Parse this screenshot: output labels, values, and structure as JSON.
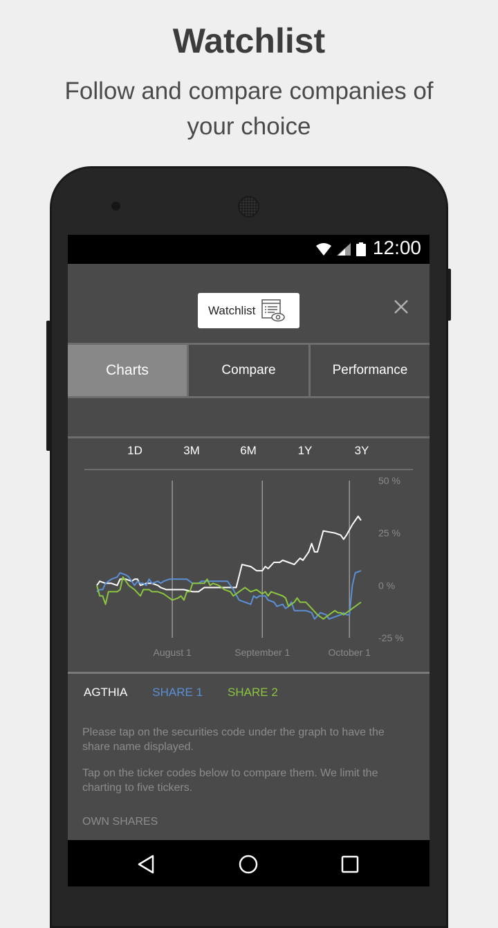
{
  "promo": {
    "title": "Watchlist",
    "subtitle": "Follow and compare companies of your choice"
  },
  "statusbar": {
    "time": "12:00",
    "icons": [
      "wifi-icon",
      "signal-icon",
      "battery-icon"
    ]
  },
  "appbar": {
    "logo_label": "Watchlist",
    "logo_icon": "watchlist-eye-icon",
    "close_icon": "close-icon"
  },
  "tabs": [
    {
      "label": "Charts",
      "active": true
    },
    {
      "label": "Compare",
      "active": false
    },
    {
      "label": "Performance",
      "active": false
    }
  ],
  "ranges": [
    "1D",
    "3M",
    "6M",
    "1Y",
    "3Y"
  ],
  "legend": [
    {
      "label": "AGTHIA",
      "color": "#ffffff"
    },
    {
      "label": "SHARE 1",
      "color": "#5b8fd6"
    },
    {
      "label": "SHARE 2",
      "color": "#8cc63f"
    }
  ],
  "info": {
    "line1": "Please tap on the securities code under the graph to have the share name displayed.",
    "line2": "Tap on the ticker codes below to compare them. We limit the charting to five tickers.",
    "own_shares": "OWN SHARES"
  },
  "navbar": [
    "back-icon",
    "home-icon",
    "recents-icon"
  ],
  "chart_data": {
    "type": "line",
    "title": "",
    "xlabel": "",
    "ylabel": "",
    "x_unit": "days from start (approx. Jul 6)",
    "xlim": [
      0,
      91
    ],
    "ylim": [
      -25,
      50
    ],
    "y_ticks": [
      50,
      25,
      0,
      -25
    ],
    "y_tick_labels": [
      "50 %",
      "25 %",
      "0 %",
      "-25 %"
    ],
    "x_ticks": [
      26,
      57,
      87
    ],
    "x_tick_labels": [
      "August 1",
      "September 1",
      "October 1"
    ],
    "grid": "vertical at x ticks",
    "series": [
      {
        "name": "AGTHIA",
        "color": "#ffffff",
        "points": [
          [
            0,
            0
          ],
          [
            1,
            2
          ],
          [
            3,
            1
          ],
          [
            5,
            1
          ],
          [
            7,
            0
          ],
          [
            8,
            3
          ],
          [
            10,
            3
          ],
          [
            12,
            2
          ],
          [
            13,
            3
          ],
          [
            14,
            3
          ],
          [
            15,
            0
          ],
          [
            17,
            1
          ],
          [
            19,
            1
          ],
          [
            21,
            0
          ],
          [
            22,
            -1
          ],
          [
            24,
            -2
          ],
          [
            27,
            -2
          ],
          [
            30,
            -2
          ],
          [
            33,
            -3
          ],
          [
            35,
            -3
          ],
          [
            37,
            -1
          ],
          [
            39,
            -1
          ],
          [
            42,
            -1
          ],
          [
            45,
            -1
          ],
          [
            48,
            -1
          ],
          [
            50,
            10
          ],
          [
            53,
            9
          ],
          [
            55,
            7
          ],
          [
            57,
            7
          ],
          [
            58,
            9
          ],
          [
            59,
            8
          ],
          [
            61,
            11
          ],
          [
            63,
            11
          ],
          [
            64,
            12
          ],
          [
            66,
            11
          ],
          [
            68,
            10
          ],
          [
            70,
            13
          ],
          [
            71,
            12
          ],
          [
            73,
            16
          ],
          [
            74,
            20
          ],
          [
            75,
            16
          ],
          [
            76,
            16
          ],
          [
            78,
            26
          ],
          [
            82,
            25
          ],
          [
            84,
            24
          ],
          [
            85,
            22
          ],
          [
            86,
            24
          ],
          [
            88,
            29
          ],
          [
            90,
            33
          ],
          [
            91,
            31
          ]
        ]
      },
      {
        "name": "SHARE 1",
        "color": "#5b8fd6",
        "points": [
          [
            0,
            -3
          ],
          [
            1,
            -2
          ],
          [
            2,
            -2
          ],
          [
            3,
            1
          ],
          [
            5,
            3
          ],
          [
            7,
            4
          ],
          [
            8,
            6
          ],
          [
            10,
            5
          ],
          [
            11,
            4
          ],
          [
            13,
            0
          ],
          [
            14,
            2
          ],
          [
            15,
            1
          ],
          [
            16,
            1
          ],
          [
            17,
            0
          ],
          [
            18,
            3
          ],
          [
            19,
            1
          ],
          [
            21,
            2
          ],
          [
            22,
            1
          ],
          [
            23,
            2
          ],
          [
            25,
            3
          ],
          [
            28,
            3
          ],
          [
            31,
            3
          ],
          [
            32,
            2
          ],
          [
            33,
            1
          ],
          [
            35,
            1
          ],
          [
            36,
            2
          ],
          [
            38,
            2
          ],
          [
            41,
            2
          ],
          [
            44,
            2
          ],
          [
            45,
            2
          ],
          [
            47,
            -2
          ],
          [
            49,
            -7
          ],
          [
            51,
            -8
          ],
          [
            53,
            -9
          ],
          [
            54,
            -5
          ],
          [
            55,
            -6
          ],
          [
            56,
            -5
          ],
          [
            58,
            -5
          ],
          [
            59,
            -7
          ],
          [
            61,
            -8
          ],
          [
            62,
            -10
          ],
          [
            64,
            -9
          ],
          [
            65,
            -11
          ],
          [
            66,
            -10
          ],
          [
            67,
            -8
          ],
          [
            68,
            -12
          ],
          [
            70,
            -12
          ],
          [
            72,
            -12
          ],
          [
            74,
            -13
          ],
          [
            75,
            -16
          ],
          [
            77,
            -13
          ],
          [
            79,
            -14
          ],
          [
            80,
            -16
          ],
          [
            82,
            -15
          ],
          [
            84,
            -14
          ],
          [
            85,
            -13
          ],
          [
            86,
            -14
          ],
          [
            87,
            -14
          ],
          [
            88,
            0
          ],
          [
            89,
            6
          ],
          [
            91,
            7
          ]
        ]
      },
      {
        "name": "SHARE 2",
        "color": "#8cc63f",
        "points": [
          [
            0,
            0
          ],
          [
            1,
            -5
          ],
          [
            2,
            -5
          ],
          [
            3,
            -9
          ],
          [
            4,
            -3
          ],
          [
            6,
            -3
          ],
          [
            7,
            -3
          ],
          [
            8,
            -2
          ],
          [
            9,
            4
          ],
          [
            11,
            0
          ],
          [
            13,
            -2
          ],
          [
            15,
            -5
          ],
          [
            16,
            -2
          ],
          [
            18,
            -2
          ],
          [
            19,
            -3
          ],
          [
            21,
            -3
          ],
          [
            23,
            -4
          ],
          [
            24,
            -5
          ],
          [
            26,
            -7
          ],
          [
            28,
            -6
          ],
          [
            29,
            -5
          ],
          [
            30,
            -7
          ],
          [
            31,
            -3
          ],
          [
            32,
            -3
          ],
          [
            33,
            1
          ],
          [
            35,
            1
          ],
          [
            37,
            1
          ],
          [
            38,
            3
          ],
          [
            39,
            0
          ],
          [
            40,
            1
          ],
          [
            42,
            0
          ],
          [
            44,
            -2
          ],
          [
            46,
            -3
          ],
          [
            47,
            -5
          ],
          [
            49,
            -3
          ],
          [
            51,
            -1
          ],
          [
            53,
            -3
          ],
          [
            55,
            -2
          ],
          [
            57,
            -4
          ],
          [
            58,
            -3
          ],
          [
            59,
            -5
          ],
          [
            60,
            -3
          ],
          [
            62,
            -4
          ],
          [
            64,
            -5
          ],
          [
            65,
            -6
          ],
          [
            66,
            -10
          ],
          [
            68,
            -8
          ],
          [
            69,
            -6
          ],
          [
            70,
            -8
          ],
          [
            72,
            -8
          ],
          [
            74,
            -11
          ],
          [
            76,
            -14
          ],
          [
            78,
            -16
          ],
          [
            80,
            -14
          ],
          [
            82,
            -12
          ],
          [
            83,
            -13
          ],
          [
            84,
            -13
          ],
          [
            85,
            -14
          ],
          [
            86,
            -13
          ],
          [
            87,
            -12
          ],
          [
            88,
            -11
          ],
          [
            89,
            -10
          ],
          [
            91,
            -8
          ]
        ]
      }
    ]
  }
}
